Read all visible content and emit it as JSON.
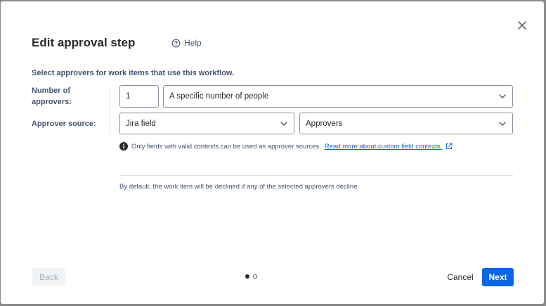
{
  "dialog": {
    "title": "Edit approval step",
    "help_label": "Help",
    "description": "Select approvers for work items that use this workflow.",
    "number_of_approvers": {
      "label": "Number of approvers:",
      "count_value": "1",
      "mode_value": "A specific number of people"
    },
    "approver_source": {
      "label": "Approver source:",
      "source_value": "Jira field",
      "field_value": "Approvers"
    },
    "info": {
      "text": "Only fields with valid contexts can be used as approver sources.",
      "link_text": "Read more about custom field contexts."
    },
    "note": "By default, the work item will be declined if any of the selected approvers decline.",
    "footer": {
      "back_label": "Back",
      "cancel_label": "Cancel",
      "next_label": "Next",
      "step_current": 1,
      "step_total": 2
    }
  },
  "colors": {
    "primary": "#0c66e4",
    "text": "#292a2e",
    "subtle_text": "#44546f",
    "border": "#8590a2"
  },
  "icons": {
    "close": "close-icon",
    "help": "question-circle-icon",
    "chevron": "chevron-down-icon",
    "info": "info-icon",
    "external_link": "external-link-icon"
  }
}
